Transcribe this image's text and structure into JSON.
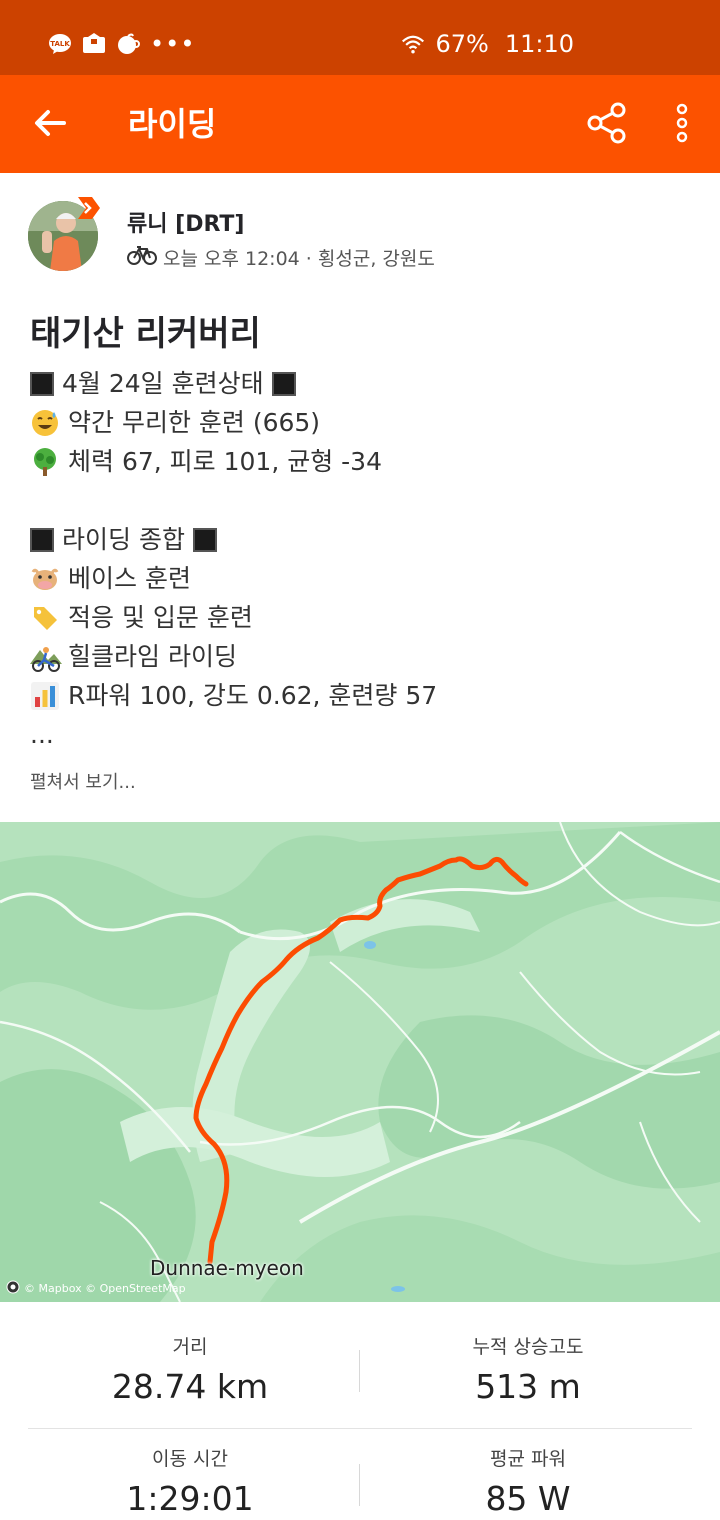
{
  "status_bar": {
    "battery": "67%",
    "time": "11:10",
    "icons": [
      "kakaotalk-icon",
      "mail-icon",
      "coffee-icon",
      "more-icon",
      "wifi-icon"
    ]
  },
  "app_bar": {
    "title": "라이딩"
  },
  "activity": {
    "athlete_name": "류니 [DRT]",
    "meta": "오늘 오후 12:04 · 횡성군, 강원도",
    "title": "태기산 리커버리",
    "description": [
      "4월 24일 훈련상태",
      "약간 무리한 훈련 (665)",
      "체력 67, 피로 101, 균형 -34",
      "",
      "라이딩 종합",
      "베이스 훈련",
      "적응 및 입문 훈련",
      "힐클라임 라이딩",
      "R파워 100, 강도 0.62, 훈련량 57",
      "..."
    ],
    "see_more": "펼쳐서 보기..."
  },
  "map": {
    "place_label": "Dunnae-myeon",
    "attribution": "© Mapbox © OpenStreetMap",
    "route_color": "#fc4c02"
  },
  "stats": [
    {
      "label": "거리",
      "value": "28.74 km"
    },
    {
      "label": "누적 상승고도",
      "value": "513 m"
    },
    {
      "label": "이동 시간",
      "value": "1:29:01"
    },
    {
      "label": "평균 파워",
      "value": "85 W"
    }
  ],
  "colors": {
    "status_bar": "#cc4200",
    "app_bar": "#fc5200",
    "map_green": "#b8e4c0"
  }
}
